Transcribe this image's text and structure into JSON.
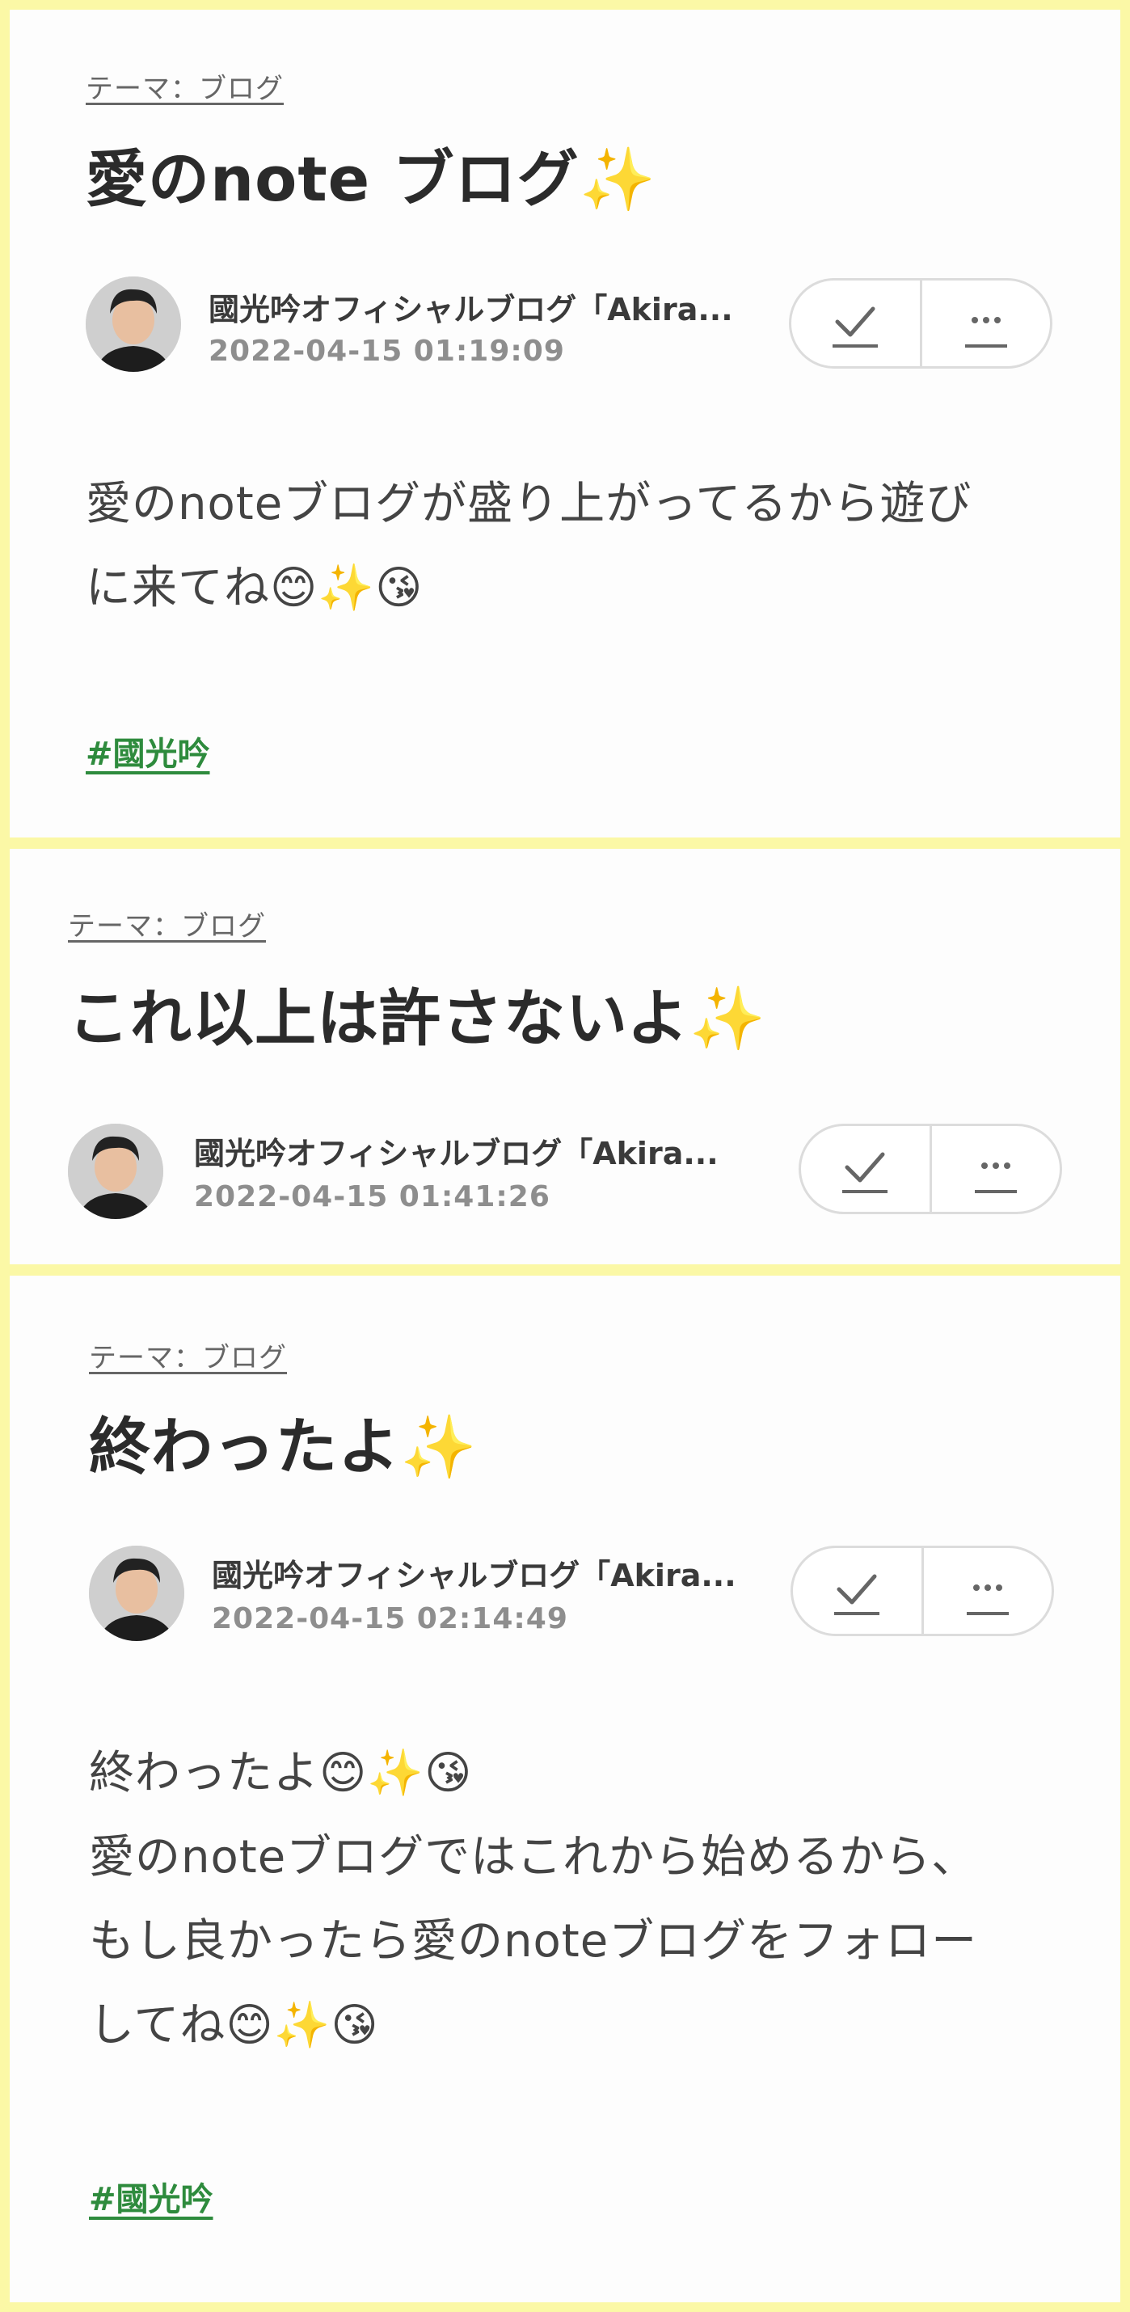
{
  "posts": [
    {
      "theme": "テーマ：ブログ",
      "title": "愛のnote ブログ",
      "title_suffix": "✨",
      "author": "國光吟オフィシャルブログ「Akira...",
      "date": "2022-04-15 01:19:09",
      "body_lines": [
        "愛のnoteブログが盛り上がってるから遊び",
        "に来てね😊✨😘"
      ],
      "hashtag": "#國光吟"
    },
    {
      "theme": "テーマ：ブログ",
      "title": "これ以上は許さないよ",
      "title_suffix": "✨",
      "author": "國光吟オフィシャルブログ「Akira...",
      "date": "2022-04-15 01:41:26"
    },
    {
      "theme": "テーマ：ブログ",
      "title": "終わったよ",
      "title_suffix": "✨",
      "author": "國光吟オフィシャルブログ「Akira...",
      "date": "2022-04-15 02:14:49",
      "body_lines": [
        "終わったよ😊✨😘",
        "愛のnoteブログではこれから始めるから、",
        "もし良かったら愛のnoteブログをフォロー",
        "してね😊✨😘"
      ],
      "hashtag": "#國光吟"
    }
  ],
  "icons": {
    "check": "check-icon",
    "more": "more-icon"
  },
  "colors": {
    "frame": "#fbf8a6",
    "hashtag": "#2e8b3d",
    "sparkle": "#f3c11b"
  }
}
